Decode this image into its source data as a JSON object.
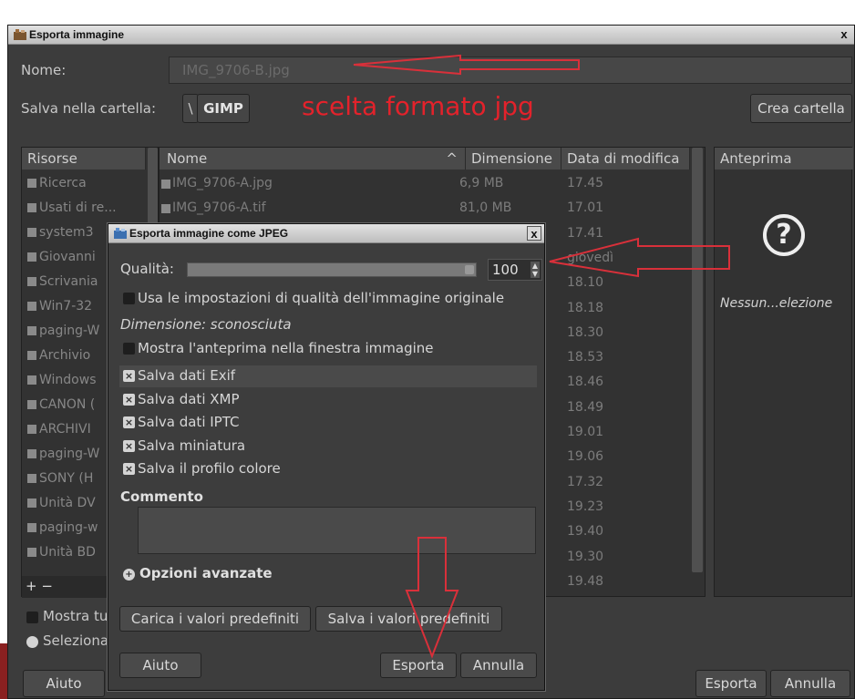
{
  "export_dialog": {
    "title": "Esporta immagine",
    "close": "x",
    "name_label": "Nome:",
    "name_value": "IMG_9706-B.jpg",
    "folder_label": "Salva nella cartella:",
    "path_separator": "\\",
    "path_current": "GIMP",
    "annotation_text": "scelta  formato jpg",
    "create_folder_button": "Crea cartella",
    "columns": {
      "places": "Risorse",
      "name": "Nome",
      "size": "Dimensione",
      "modified": "Data di modifica",
      "preview": "Anteprima"
    },
    "sort_indicator": "^",
    "places": [
      {
        "label": "Ricerca",
        "icon": "search-icon"
      },
      {
        "label": "Usati di re...",
        "icon": "recent-icon"
      },
      {
        "label": "system3",
        "icon": "folder-icon"
      },
      {
        "label": "Giovanni",
        "icon": "folder-icon"
      },
      {
        "label": "Scrivania",
        "icon": "folder-icon"
      },
      {
        "label": "Win7-32",
        "icon": "drive-icon"
      },
      {
        "label": "paging-W",
        "icon": "drive-icon"
      },
      {
        "label": "Archivio",
        "icon": "drive-icon"
      },
      {
        "label": "Windows",
        "icon": "drive-icon"
      },
      {
        "label": "CANON (",
        "icon": "drive-icon"
      },
      {
        "label": "ARCHIVI",
        "icon": "drive-icon"
      },
      {
        "label": "paging-W",
        "icon": "drive-icon"
      },
      {
        "label": "SONY (H",
        "icon": "drive-icon"
      },
      {
        "label": "Unità DV",
        "icon": "optical-drive-icon"
      },
      {
        "label": "paging-w",
        "icon": "drive-icon"
      },
      {
        "label": "Unità BD",
        "icon": "optical-drive-icon"
      }
    ],
    "add_remove": "+ −",
    "files": [
      {
        "name": "IMG_9706-A.jpg",
        "size": "6,9 MB",
        "modified": "17.45"
      },
      {
        "name": "IMG_9706-A.tif",
        "size": "81,0 MB",
        "modified": "17.01"
      },
      {
        "name": "",
        "size": "",
        "modified": "17.41"
      },
      {
        "name": "",
        "size": "",
        "modified": "giovedì"
      },
      {
        "name": "",
        "size": "",
        "modified": "18.10"
      },
      {
        "name": "",
        "size": "",
        "modified": "18.18"
      },
      {
        "name": "",
        "size": "",
        "modified": "18.30"
      },
      {
        "name": "",
        "size": "",
        "modified": "18.53"
      },
      {
        "name": "",
        "size": "",
        "modified": "18.46"
      },
      {
        "name": "",
        "size": "",
        "modified": "18.49"
      },
      {
        "name": "",
        "size": "",
        "modified": "19.01"
      },
      {
        "name": "",
        "size": "",
        "modified": "19.06"
      },
      {
        "name": "",
        "size": "",
        "modified": "17.32"
      },
      {
        "name": "",
        "size": "",
        "modified": "19.23"
      },
      {
        "name": "",
        "size": "",
        "modified": "19.40"
      },
      {
        "name": "",
        "size": "",
        "modified": "19.30"
      },
      {
        "name": "",
        "size": "",
        "modified": "19.48"
      }
    ],
    "preview_placeholder": "?",
    "preview_text": "Nessun...elezione",
    "show_all_label": "Mostra tu",
    "select_label": "Seleziona",
    "help_button": "Aiuto",
    "export_button": "Esporta",
    "cancel_button": "Annulla"
  },
  "jpeg_dialog": {
    "title": "Esporta immagine come JPEG",
    "close": "x",
    "quality_label": "Qualità:",
    "quality_value": "100",
    "quality_fraction": 1.0,
    "use_original_quality": "Usa le impostazioni di qualità dell'immagine originale",
    "dimension_text": "Dimensione: sconosciuta",
    "show_preview": "Mostra l'anteprima nella finestra immagine",
    "options": [
      {
        "label": "Salva dati Exif",
        "checked": true
      },
      {
        "label": "Salva dati XMP",
        "checked": true
      },
      {
        "label": "Salva dati IPTC",
        "checked": true
      },
      {
        "label": "Salva miniatura",
        "checked": true
      },
      {
        "label": "Salva il profilo colore",
        "checked": true
      }
    ],
    "check_mark": "×",
    "comment_label": "Commento",
    "comment_value": "",
    "advanced_label": "Opzioni avanzate",
    "load_defaults_button": "Carica i valori predefiniti",
    "save_defaults_button": "Salva i valori predefiniti",
    "help_button": "Aiuto",
    "export_button": "Esporta",
    "cancel_button": "Annulla"
  },
  "colors": {
    "annotation": "#e3222b",
    "dialog_bg": "#3c3c3c",
    "titlebar": "#d0d0d0"
  }
}
